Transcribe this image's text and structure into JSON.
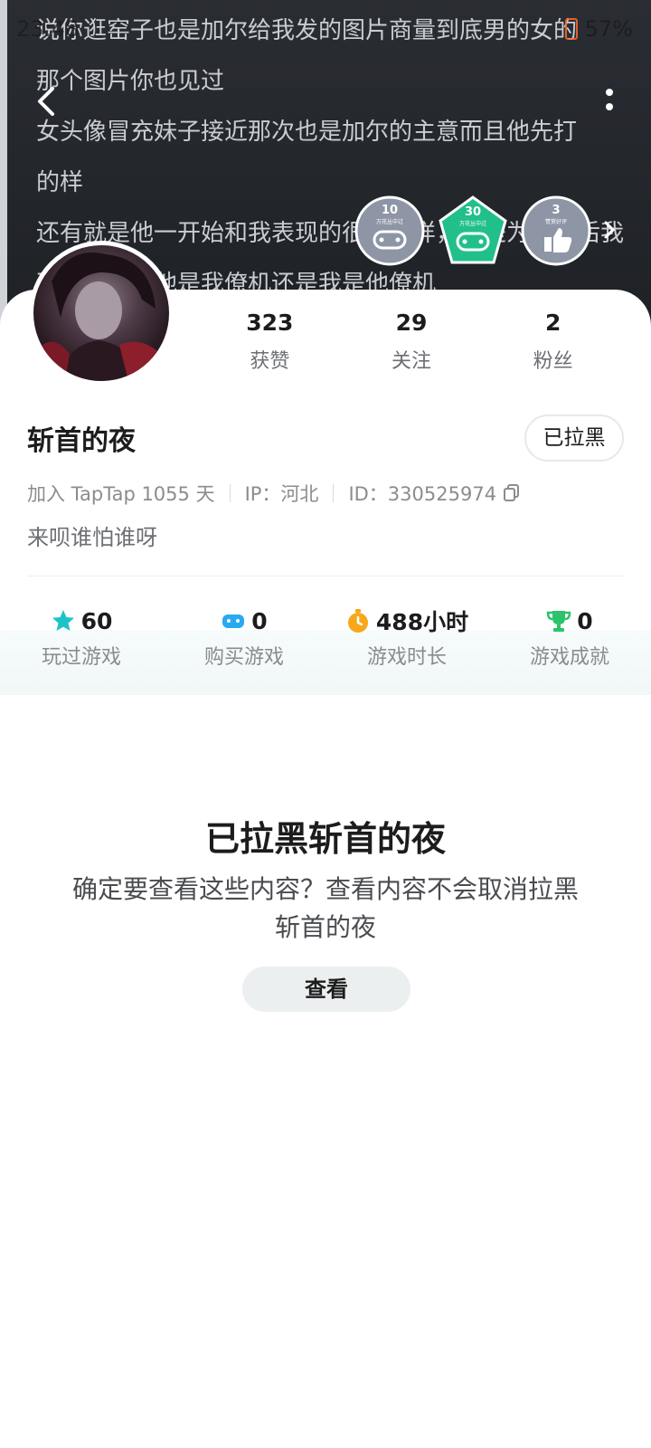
{
  "status_bar": {
    "time": "23:48",
    "battery": "57%"
  },
  "header_text": [
    "说你逛窑子也是加尔给我发的图片商量到底男的女的",
    "那个图片你也见过",
    "女头像冒充妹子接近那次也是加尔的主意而且他先打",
    "的样",
    "还有就是他一开始和我表现的很不一样，也是为了往后我",
    "不过这算是他是我僚机还是我是他僚机"
  ],
  "badges": [
    {
      "number": "10",
      "caption": "万花丛中过",
      "color": "#8e96a6"
    },
    {
      "number": "30",
      "caption": "万花丛中过",
      "color": "#21c08a"
    },
    {
      "number": "3",
      "caption": "赞赏好评",
      "color": "#8e96a6"
    }
  ],
  "stats": [
    {
      "value": "323",
      "label": "获赞"
    },
    {
      "value": "29",
      "label": "关注"
    },
    {
      "value": "2",
      "label": "粉丝"
    }
  ],
  "profile": {
    "username": "斩首的夜",
    "blocked_label": "已拉黑",
    "join_info": "加入 TapTap 1055 天",
    "ip": "IP：河北",
    "id": "ID：330525974",
    "bio": "来呗谁怕谁呀"
  },
  "game_stats": [
    {
      "value": "60",
      "label": "玩过游戏",
      "icon": "star-icon",
      "color": "#1cc3c8"
    },
    {
      "value": "0",
      "label": "购买游戏",
      "icon": "gamepad-icon",
      "color": "#29a9f2"
    },
    {
      "value": "488小时",
      "label": "游戏时长",
      "icon": "stopwatch-icon",
      "color": "#f7a81b"
    },
    {
      "value": "0",
      "label": "游戏成就",
      "icon": "trophy-icon",
      "color": "#2cc36b"
    }
  ],
  "block_notice": {
    "title": "已拉黑斩首的夜",
    "description": "确定要查看这些内容？查看内容不会取消拉黑斩首的夜",
    "view_button": "查看"
  }
}
